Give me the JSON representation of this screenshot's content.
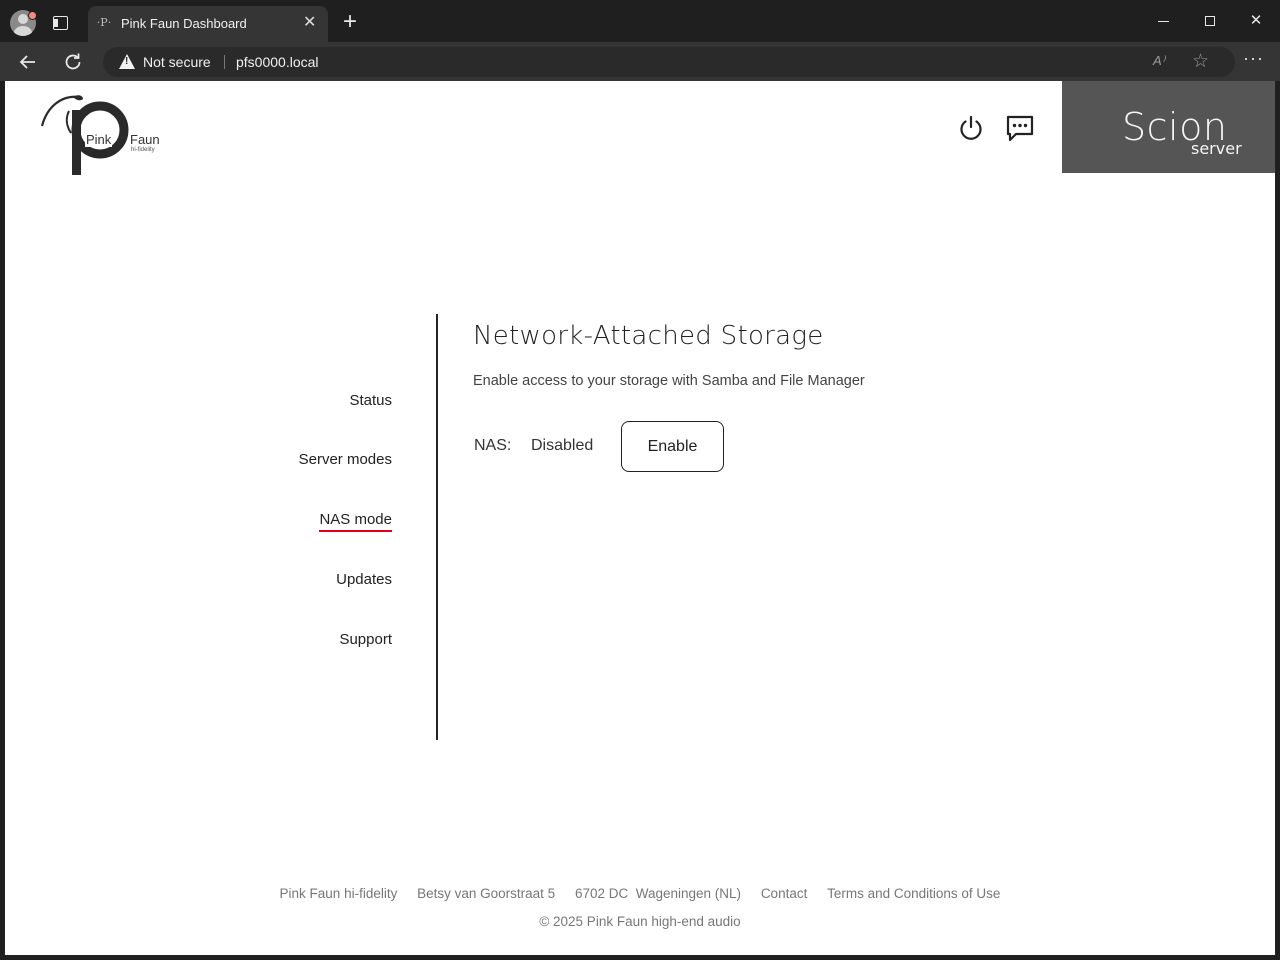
{
  "browser": {
    "tab_favicon": "·P·",
    "tab_title": "Pink Faun Dashboard",
    "tab_close": "✕",
    "new_tab": "+",
    "security_label": "Not secure",
    "url": "pfs0000.local",
    "read_aloud": "A⁾",
    "window": {
      "close": "✕"
    },
    "icons": [
      "profile-icon",
      "tab-actions-icon",
      "back-icon",
      "refresh-icon",
      "warning-icon",
      "read-aloud-icon",
      "favorite-star-icon",
      "more-icon",
      "minimize-icon",
      "maximize-icon",
      "close-icon"
    ]
  },
  "header": {
    "logo": {
      "pink": "Pink",
      "faun": "Faun",
      "tagline": "hi-fidelity"
    },
    "icons": [
      "power-icon",
      "chat-icon"
    ],
    "brand": {
      "name": "Scion",
      "sub": "server",
      "bg_color": "#555555"
    }
  },
  "sidebar": {
    "items": [
      {
        "label": "Status",
        "active": false
      },
      {
        "label": "Server modes",
        "active": false
      },
      {
        "label": "NAS mode",
        "active": true
      },
      {
        "label": "Updates",
        "active": false
      },
      {
        "label": "Support",
        "active": false
      }
    ],
    "active_underline_color": "#e3001b"
  },
  "main": {
    "title": "Network-Attached Storage",
    "description": "Enable access to your storage with Samba and File Manager",
    "nas_label": "NAS:",
    "nas_status": "Disabled",
    "enable_label": "Enable"
  },
  "footer": {
    "company": "Pink Faun hi-fidelity",
    "street": "Betsy van Goorstraat 5",
    "city": "6702 DC  Wageningen (NL)",
    "contact": "Contact",
    "terms": "Terms and Conditions of Use",
    "copyright": "© 2025 Pink Faun high-end audio"
  }
}
